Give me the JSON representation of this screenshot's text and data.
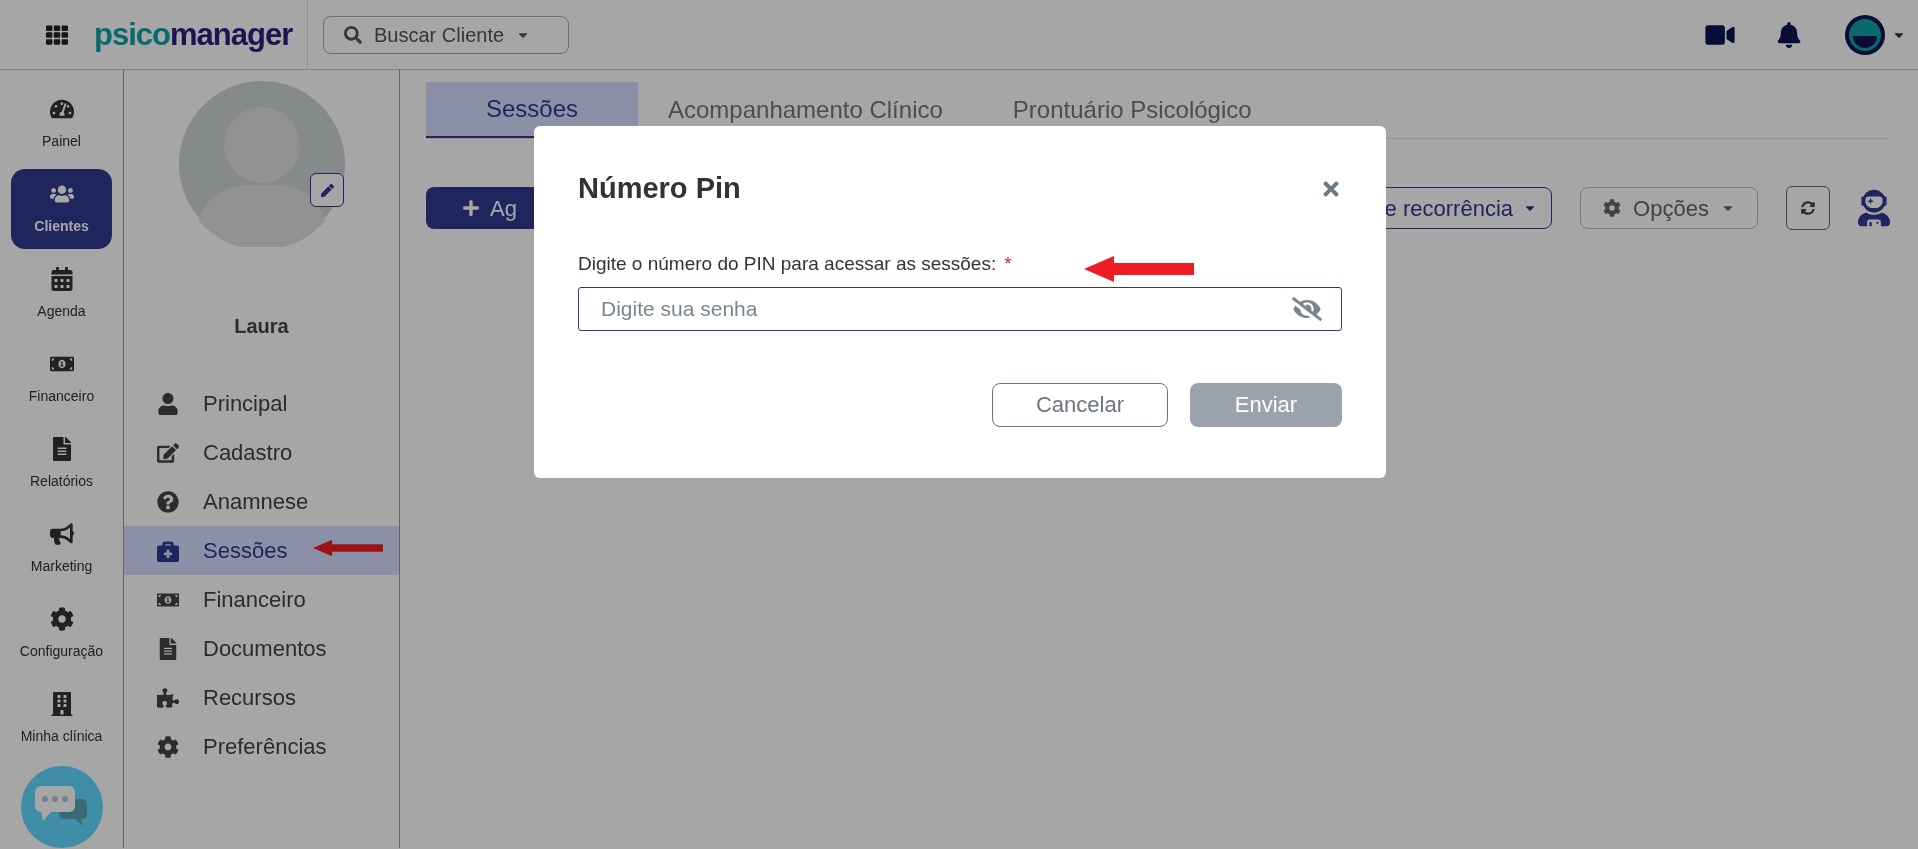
{
  "top_bar": {
    "logo_lead": "psico",
    "logo_rest": "manager",
    "search": {
      "label": "Buscar Cliente"
    }
  },
  "rail": {
    "items": [
      {
        "label": "Painel",
        "selected": false
      },
      {
        "label": "Clientes",
        "selected": true
      },
      {
        "label": "Agenda",
        "selected": false
      },
      {
        "label": "Financeiro",
        "selected": false
      },
      {
        "label": "Relatórios",
        "selected": false
      },
      {
        "label": "Marketing",
        "selected": false
      },
      {
        "label": "Configuração",
        "selected": false
      },
      {
        "label": "Minha clínica",
        "selected": false
      }
    ]
  },
  "client": {
    "name": "Laura",
    "menu": [
      {
        "label": "Principal",
        "selected": false
      },
      {
        "label": "Cadastro",
        "selected": false
      },
      {
        "label": "Anamnese",
        "selected": false
      },
      {
        "label": "Sessões",
        "selected": true
      },
      {
        "label": "Financeiro",
        "selected": false
      },
      {
        "label": "Documentos",
        "selected": false
      },
      {
        "label": "Recursos",
        "selected": false
      },
      {
        "label": "Preferências",
        "selected": false
      }
    ]
  },
  "tabs": [
    {
      "label": "Sessões",
      "selected": true
    },
    {
      "label": "Acompanhamento Clínico",
      "selected": false
    },
    {
      "label": "Prontuário Psicológico",
      "selected": false
    }
  ],
  "toolbar": {
    "add_button": "Ag",
    "recurrence_button": "e recorrência",
    "options_button": "Opções"
  },
  "modal": {
    "title": "Número Pin",
    "label": "Digite o número do PIN para acessar as sessões:",
    "required_mark": "*",
    "placeholder": "Digite sua senha",
    "buttons": [
      {
        "label": "Cancelar",
        "disabled": false
      },
      {
        "label": "Enviar",
        "disabled": true
      }
    ]
  }
}
